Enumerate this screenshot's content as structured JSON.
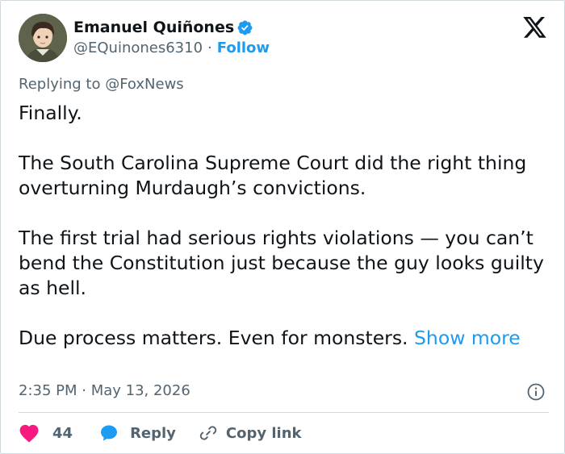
{
  "author": {
    "display_name": "Emanuel Quiñones",
    "handle": "@EQuinones6310",
    "separator": "·",
    "follow_label": "Follow",
    "verified": true
  },
  "reply_to": "Replying to @FoxNews",
  "tweet": {
    "paragraphs": [
      "Finally.",
      "The South Carolina Supreme Court did the right thing overturning Murdaugh’s convictions.",
      "The first trial had serious rights violations — you can’t bend the Constitution just because the guy looks guilty as hell.",
      "Due process matters. Even for monsters."
    ],
    "show_more": "Show more"
  },
  "timestamp": "2:35 PM · May 13, 2026",
  "actions": {
    "likes": "44",
    "reply_label": "Reply",
    "copy_link_label": "Copy link"
  },
  "colors": {
    "accent": "#1d9bf0",
    "heart": "#f91880",
    "muted": "#536471",
    "text": "#0f1419"
  },
  "icons": [
    "verified-badge-icon",
    "x-logo-icon",
    "info-icon",
    "heart-icon",
    "reply-bubble-icon",
    "link-icon"
  ]
}
